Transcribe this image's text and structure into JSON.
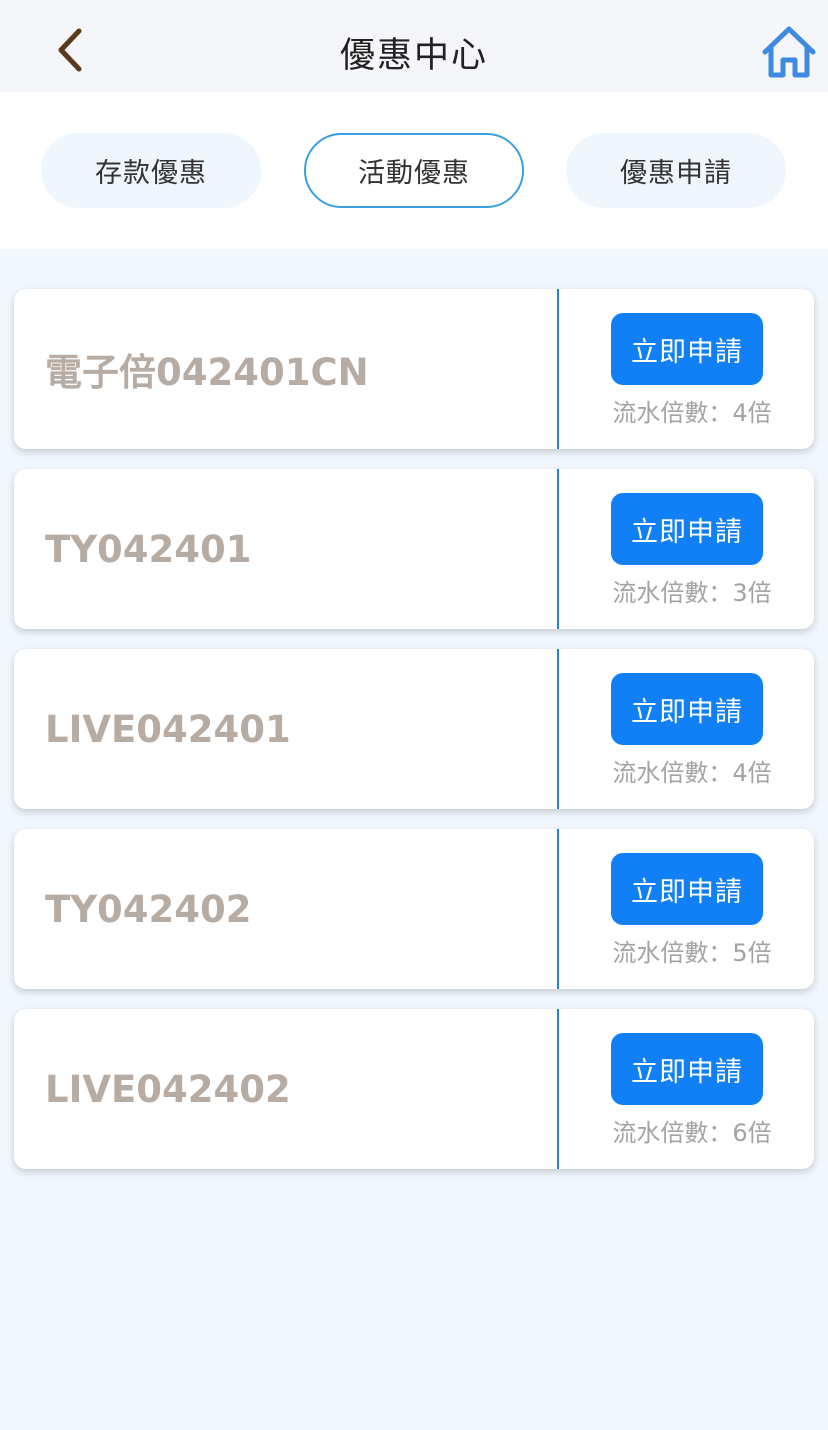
{
  "header": {
    "title": "優惠中心"
  },
  "tabs": [
    {
      "label": "存款優惠",
      "active": false
    },
    {
      "label": "活動優惠",
      "active": true
    },
    {
      "label": "優惠申請",
      "active": false
    }
  ],
  "colors": {
    "accent": "#1180f6",
    "active_tab_border": "#3a9fe0",
    "back_icon": "#5a3a1a",
    "home_icon": "#3d8ae0",
    "card_name": "#b7aca3"
  },
  "icons": {
    "back": "chevron-left-icon",
    "home": "home-icon"
  },
  "promotions": [
    {
      "name": "電子倍042401CN",
      "button": "立即申請",
      "multiplier": "流水倍數：4倍"
    },
    {
      "name": "TY042401",
      "button": "立即申請",
      "multiplier": "流水倍數：3倍"
    },
    {
      "name": "LIVE042401",
      "button": "立即申請",
      "multiplier": "流水倍數：4倍"
    },
    {
      "name": "TY042402",
      "button": "立即申請",
      "multiplier": "流水倍數：5倍"
    },
    {
      "name": "LIVE042402",
      "button": "立即申請",
      "multiplier": "流水倍數：6倍"
    }
  ]
}
